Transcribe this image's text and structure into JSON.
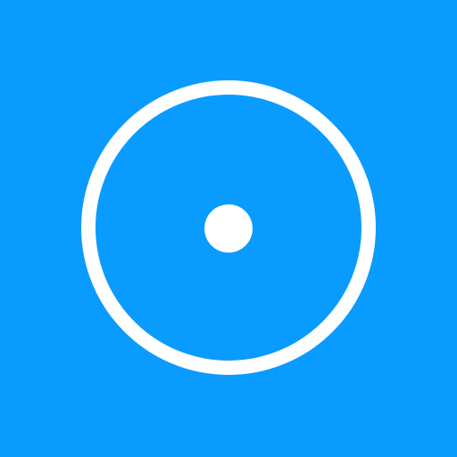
{
  "icon": {
    "name": "radio-button-icon",
    "background_color": "#0A9BFF",
    "foreground_color": "#FFFFFF"
  }
}
